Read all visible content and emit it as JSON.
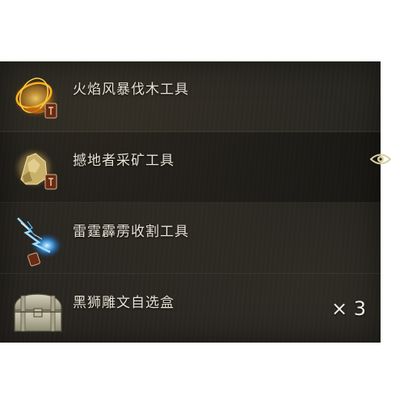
{
  "items": [
    {
      "name": "火焰风暴伐木工具",
      "icon": "fire-ring-axe-icon"
    },
    {
      "name": "撼地者采矿工具",
      "icon": "earth-crystal-pickaxe-icon",
      "visible_indicator": "eye-icon"
    },
    {
      "name": "雷霆霹雳收割工具",
      "icon": "lightning-sickle-icon"
    },
    {
      "name": "黑狮雕文自选盒",
      "icon": "treasure-chest-icon",
      "quantity": "× 3"
    }
  ],
  "colors": {
    "panel_bg": "#26241f",
    "label_text": "#e8e2d4",
    "eye_accent": "#d8cfa0"
  }
}
